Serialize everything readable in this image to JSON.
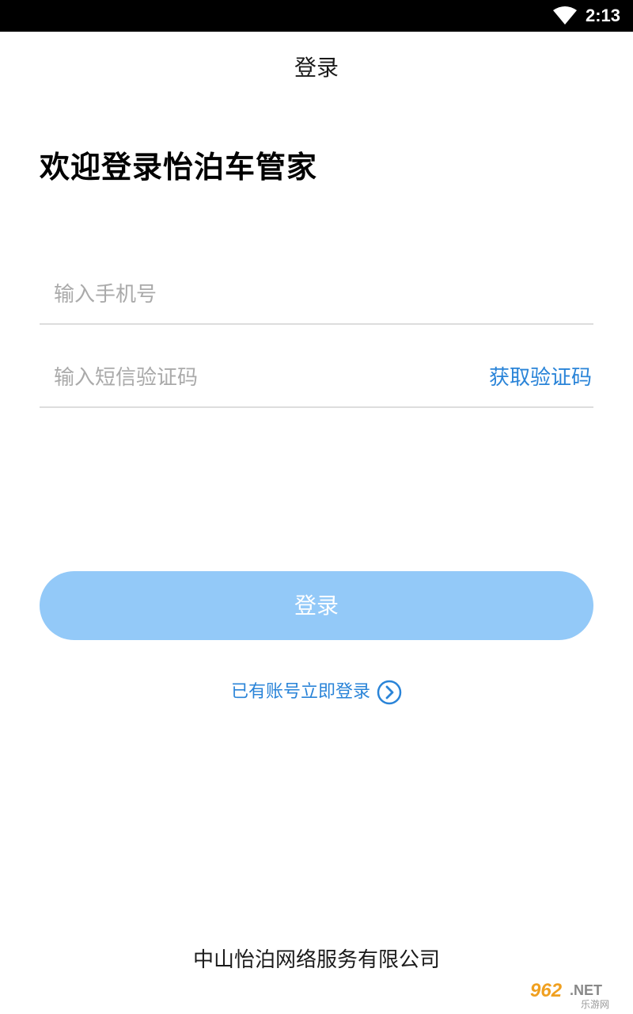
{
  "statusbar": {
    "time": "2:13",
    "wifi_icon": "wifi-icon"
  },
  "header": {
    "title": "登录"
  },
  "welcome": {
    "text": "欢迎登录怡泊车管家"
  },
  "form": {
    "phone_placeholder": "输入手机号",
    "code_placeholder": "输入短信验证码",
    "get_code_label": "获取验证码"
  },
  "login_button": {
    "label": "登录",
    "background": "#93c9f8"
  },
  "existing_account": {
    "label": "已有账号立即登录",
    "icon": "chevron-right-circle-icon"
  },
  "footer": {
    "company": "中山怡泊网络服务有限公司"
  },
  "watermark": {
    "logo_text": "962.NET",
    "sub_text": "乐游网"
  },
  "colors": {
    "accent": "#2a84d8",
    "button": "#93c9f8",
    "divider": "#dddddd"
  }
}
